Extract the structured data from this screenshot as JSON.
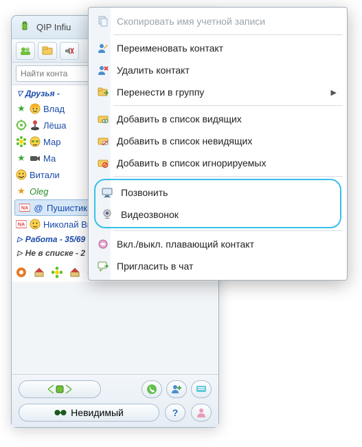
{
  "window": {
    "title": "QIP Infiu"
  },
  "search": {
    "placeholder": "Найти конта"
  },
  "groups": {
    "friends": "Друзья -",
    "work": "Работа - 35/69",
    "not_in_list": "Не в списке - 2"
  },
  "contacts": {
    "c0": "Влад",
    "c1": "Лёша",
    "c2": "Мар",
    "c3": "Ма",
    "c4": "Витали",
    "c5": "Oleg",
    "c6": "Пушистик",
    "c7": "Николай Витальевич"
  },
  "status": {
    "invisible": "Невидимый"
  },
  "menu": {
    "copy_account": "Скопировать имя учетной записи",
    "rename": "Переименовать контакт",
    "delete": "Удалить контакт",
    "move_to_group": "Перенести в группу",
    "add_visible": "Добавить в список видящих",
    "add_invisible": "Добавить в список невидящих",
    "add_ignore": "Добавить в список игнорируемых",
    "call": "Позвонить",
    "video_call": "Видеозвонок",
    "toggle_floating": "Вкл./выкл. плавающий контакт",
    "invite_chat": "Пригласить в чат"
  }
}
